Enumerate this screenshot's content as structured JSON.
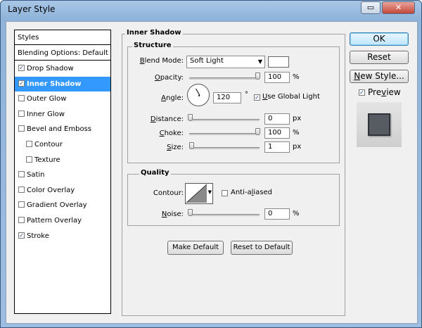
{
  "window": {
    "title": "Layer Style",
    "minimize": "▭",
    "close": "✕"
  },
  "styles_list": {
    "header": "Styles",
    "blending": "Blending Options: Default",
    "items": [
      {
        "label": "Drop Shadow",
        "checked": true,
        "selected": false,
        "indent": false
      },
      {
        "label": "Inner Shadow",
        "checked": true,
        "selected": true,
        "indent": false
      },
      {
        "label": "Outer Glow",
        "checked": false,
        "selected": false,
        "indent": false
      },
      {
        "label": "Inner Glow",
        "checked": false,
        "selected": false,
        "indent": false
      },
      {
        "label": "Bevel and Emboss",
        "checked": false,
        "selected": false,
        "indent": false
      },
      {
        "label": "Contour",
        "checked": false,
        "selected": false,
        "indent": true
      },
      {
        "label": "Texture",
        "checked": false,
        "selected": false,
        "indent": true
      },
      {
        "label": "Satin",
        "checked": false,
        "selected": false,
        "indent": false
      },
      {
        "label": "Color Overlay",
        "checked": false,
        "selected": false,
        "indent": false
      },
      {
        "label": "Gradient Overlay",
        "checked": false,
        "selected": false,
        "indent": false
      },
      {
        "label": "Pattern Overlay",
        "checked": false,
        "selected": false,
        "indent": false
      },
      {
        "label": "Stroke",
        "checked": true,
        "selected": false,
        "indent": false
      }
    ]
  },
  "inner_shadow": {
    "title": "Inner Shadow",
    "structure": {
      "title": "Structure",
      "blend_mode_label": "Blend Mode:",
      "blend_mode_value": "Soft Light",
      "blend_color": "#ffffff",
      "opacity_label": "Opacity:",
      "opacity_value": "100",
      "opacity_unit": "%",
      "angle_label": "Angle:",
      "angle_value": "120",
      "angle_unit": "°",
      "use_global_light_label": "Use Global Light",
      "use_global_light_checked": true,
      "distance_label": "Distance:",
      "distance_value": "0",
      "distance_unit": "px",
      "choke_label": "Choke:",
      "choke_value": "100",
      "choke_unit": "%",
      "size_label": "Size:",
      "size_value": "1",
      "size_unit": "px"
    },
    "quality": {
      "title": "Quality",
      "contour_label": "Contour:",
      "anti_aliased_label": "Anti-aliased",
      "anti_aliased_checked": false,
      "noise_label": "Noise:",
      "noise_value": "0",
      "noise_unit": "%"
    },
    "make_default": "Make Default",
    "reset_to_default": "Reset to Default"
  },
  "side_buttons": {
    "ok": "OK",
    "reset": "Reset",
    "new_style": "New Style...",
    "preview_label": "Preview",
    "preview_checked": true
  }
}
